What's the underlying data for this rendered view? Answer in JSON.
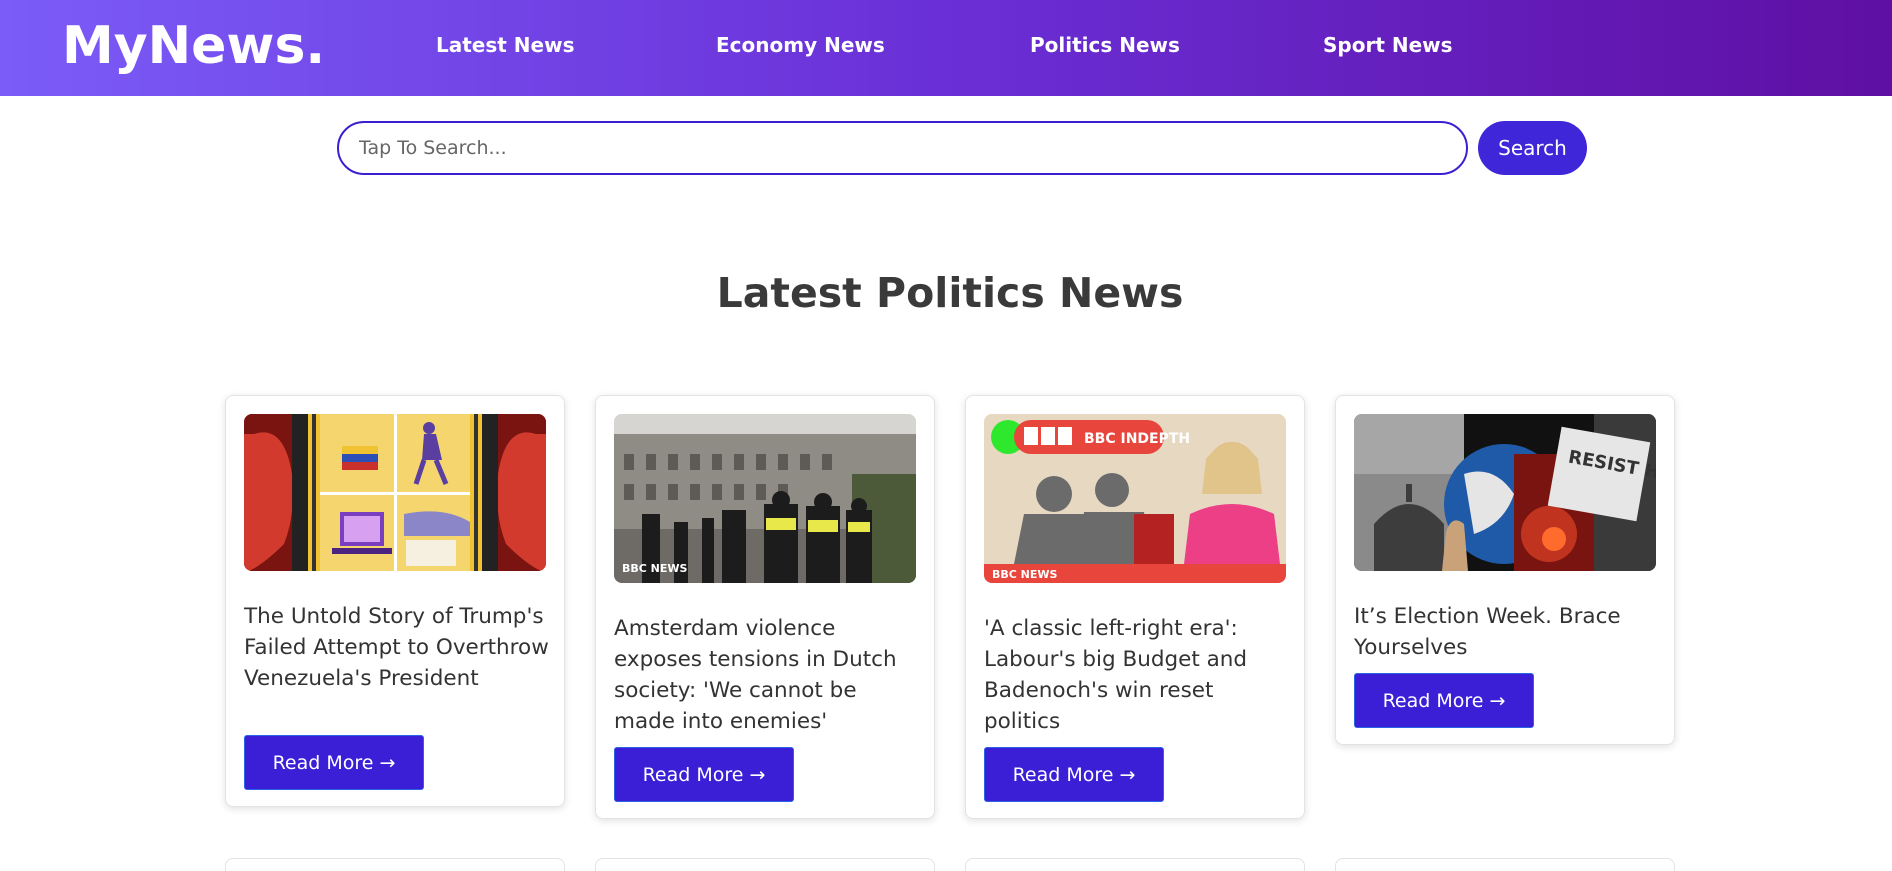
{
  "header": {
    "logo": "MyNews.",
    "nav": [
      "Latest News",
      "Economy News",
      "Politics News",
      "Sport News"
    ]
  },
  "search": {
    "placeholder": "Tap To Search...",
    "value": "",
    "button_label": "Search"
  },
  "section": {
    "title": "Latest Politics News"
  },
  "cards": [
    {
      "title": "The Untold Story of Trump's Failed Attempt to Overthrow Venezuela's President",
      "button_label": "Read More →"
    },
    {
      "title": "Amsterdam violence exposes tensions in Dutch society: 'We cannot be made into enemies'",
      "image_badge": "BBC NEWS",
      "button_label": "Read More →"
    },
    {
      "title": "'A classic left-right era': Labour's big Budget and Badenoch's win reset politics",
      "image_badge": "BBC INDEPTH",
      "image_badge_bottom": "BBC NEWS",
      "button_label": "Read More →"
    },
    {
      "title": "It’s Election Week. Brace Yourselves",
      "image_text": "RESIST HATE",
      "button_label": "Read More →"
    }
  ],
  "colors": {
    "nav_gradient_start": "#7b5cf8",
    "nav_gradient_end": "#5f0fa3",
    "accent": "#3a1fd6",
    "title_text": "#3a3a3a"
  }
}
